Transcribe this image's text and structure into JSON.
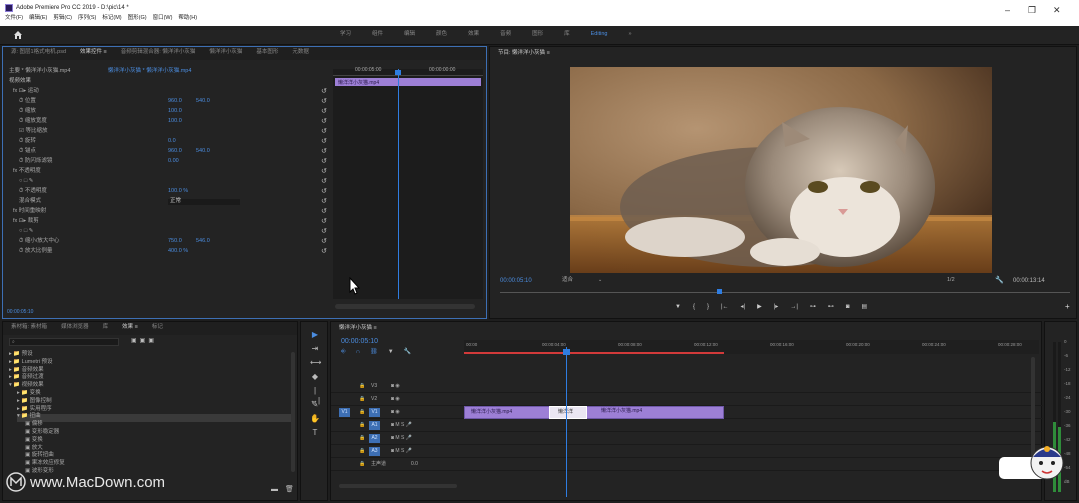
{
  "window": {
    "title": "Adobe Premiere Pro CC 2019 - D:\\pic\\14 *",
    "menu": [
      "文件(F)",
      "编辑(E)",
      "剪辑(C)",
      "序列(S)",
      "标记(M)",
      "图形(G)",
      "窗口(W)",
      "帮助(H)"
    ],
    "controls": [
      "–",
      "❐",
      "✕"
    ]
  },
  "workspace": {
    "tabs": [
      "学习",
      "组件",
      "编辑",
      "颜色",
      "效果",
      "音频",
      "图形",
      "库",
      "Editing",
      "»"
    ],
    "active": "Editing",
    "icons": [
      "home-icon"
    ]
  },
  "effect_controls": {
    "tabs": [
      "源: 图层1格式电机.psd",
      "效果控件 ≡",
      "音频剪辑混合器: 懒洋洋小灰猫",
      "懒洋洋小灰猫",
      "基本图形",
      "元数据"
    ],
    "active_tab": "效果控件 ≡",
    "source": "主要 * 懒洋洋小灰猫.mp4",
    "clip": "懒洋洋小灰猫 * 懒洋洋小灰猫.mp4",
    "section": "视频效果",
    "timecodes": [
      "00:00:05:00",
      "00:00:00:00"
    ],
    "clip_label": "懒洋洋小灰猫.mp4",
    "rows": [
      {
        "label": "fx ⊡▸ 运动",
        "v1": "",
        "v2": ""
      },
      {
        "label": "⏱ 位置",
        "v1": "960.0",
        "v2": "540.0"
      },
      {
        "label": "⏱ 缩放",
        "v1": "100.0",
        "v2": ""
      },
      {
        "label": "⏱ 缩放宽度",
        "v1": "100.0",
        "v2": ""
      },
      {
        "label": "☑ 等比缩放",
        "v1": "",
        "v2": ""
      },
      {
        "label": "⏱ 旋转",
        "v1": "0.0",
        "v2": ""
      },
      {
        "label": "⏱ 锚点",
        "v1": "960.0",
        "v2": "540.0"
      },
      {
        "label": "⏱ 防闪烁滤镜",
        "v1": "0.00",
        "v2": ""
      },
      {
        "label": "fx 不透明度",
        "v1": "",
        "v2": ""
      },
      {
        "label": "○ □ ✎",
        "v1": "",
        "v2": ""
      },
      {
        "label": "⏱ 不透明度",
        "v1": "100.0 %",
        "v2": ""
      },
      {
        "label": "混合模式",
        "v1": "正常",
        "v2": ""
      },
      {
        "label": "fx 时间重映射",
        "v1": "",
        "v2": ""
      },
      {
        "label": "fx ⊡▸ 裁剪",
        "v1": "",
        "v2": ""
      },
      {
        "label": "○ □ ✎",
        "v1": "",
        "v2": ""
      },
      {
        "label": "⏱ 缩小/放大中心",
        "v1": "750.0",
        "v2": "546.0"
      },
      {
        "label": "⏱ 放大比例量",
        "v1": "400.0 %",
        "v2": ""
      }
    ],
    "footer_timecode": "00:00:05:10"
  },
  "program": {
    "tab": "节目: 懒洋洋小灰猫 ≡",
    "timecode": "00:00:05:10",
    "fit": "适合",
    "ratio": "1/2",
    "duration": "00:00:13:14"
  },
  "project": {
    "tabs": [
      "素材箱: 素材箱",
      "媒体浏览器",
      "库",
      "效果 ≡",
      "标记"
    ],
    "active_tab": "效果 ≡",
    "search_placeholder": "",
    "tree": [
      {
        "label": "▸ 📁 预设",
        "indent": 0
      },
      {
        "label": "▸ 📁 Lumetri 预设",
        "indent": 0
      },
      {
        "label": "▸ 📁 音频效果",
        "indent": 0
      },
      {
        "label": "▸ 📁 音频过渡",
        "indent": 0
      },
      {
        "label": "▾ 📁 视频效果",
        "indent": 0
      },
      {
        "label": "▸ 📁 变换",
        "indent": 1
      },
      {
        "label": "▸ 📁 图像控制",
        "indent": 1
      },
      {
        "label": "▸ 📁 实用程序",
        "indent": 1
      },
      {
        "label": "▾ 📁 扭曲",
        "indent": 1
      },
      {
        "label": "▣ 偏移",
        "indent": 2
      },
      {
        "label": "▣ 变形稳定器",
        "indent": 2
      },
      {
        "label": "▣ 变换",
        "indent": 2
      },
      {
        "label": "▣ 放大",
        "indent": 2
      },
      {
        "label": "▣ 旋转扭曲",
        "indent": 2
      },
      {
        "label": "▣ 果冻效应修复",
        "indent": 2
      },
      {
        "label": "▣ 波形变形",
        "indent": 2
      }
    ]
  },
  "tools": [
    "▶",
    "⇥",
    "⟷",
    "◆",
    "|↔|",
    "✎",
    "✋",
    "T"
  ],
  "timeline": {
    "tab": "懒洋洋小灰猫 ≡",
    "timecode": "00:00:05:10",
    "ruler": [
      "00:00",
      "00:00:04:00",
      "00:00:08:00",
      "00:00:12:00",
      "00:00:16:00",
      "00:00:20:00",
      "00:00:24:00",
      "00:00:28:00"
    ],
    "tracks": [
      "V3",
      "V2",
      "V1",
      "A1",
      "A2",
      "A3",
      "主声道"
    ],
    "master_value": "0.0",
    "clips": [
      "懒洋洋小灰猫.mp4",
      "懒洋洋",
      "懒洋洋小灰猫.mp4"
    ]
  },
  "meter": {
    "scale": [
      "0",
      "-6",
      "-12",
      "-18",
      "-24",
      "-30",
      "-36",
      "-42",
      "-48",
      "-54",
      "dB"
    ]
  },
  "watermark": "www.MacDown.com",
  "colors": {
    "accent": "#4b8de0",
    "clip": "#9d7fd6",
    "panel": "#232323",
    "marker_red": "#d23a3a"
  }
}
